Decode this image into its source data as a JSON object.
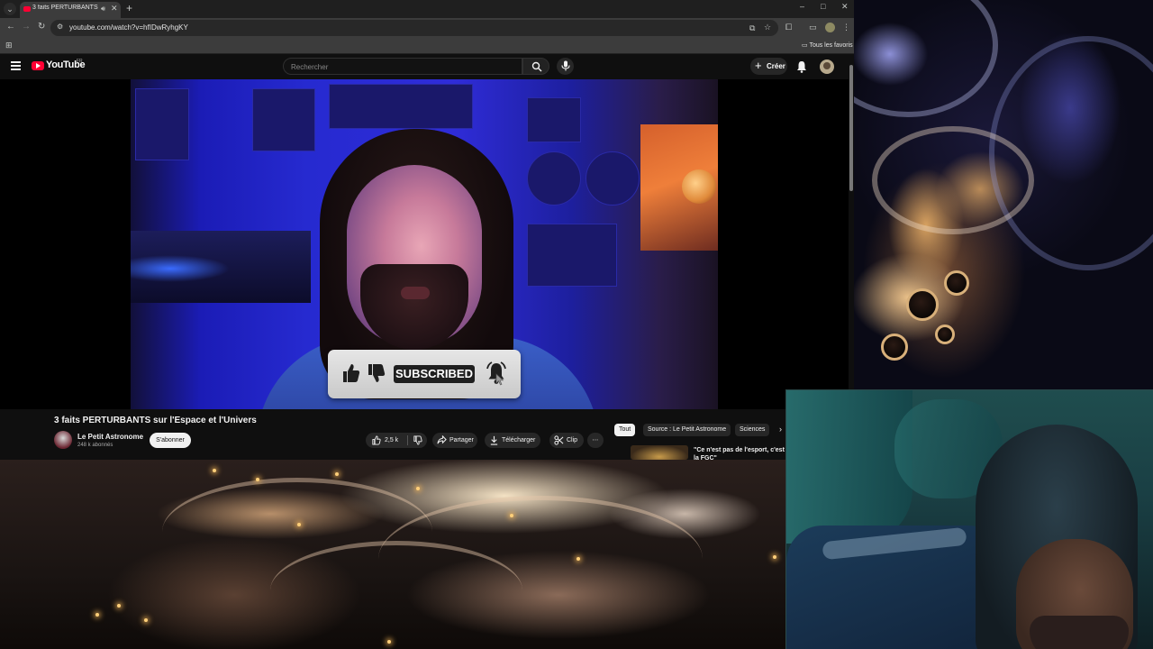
{
  "browser": {
    "tab_title": "3 faits PERTURBANTS sur l'Espace et l'Univers - YouTube",
    "url": "youtube.com/watch?v=hfIDwRyhgKY",
    "bookmarks_folder": "Tous les favoris",
    "window_controls": {
      "minimize": "–",
      "maximize": "□",
      "close": "✕"
    }
  },
  "youtube": {
    "wordmark": "YouTube",
    "country_code": "FR",
    "search_placeholder": "Rechercher",
    "create_label": "Créer"
  },
  "video": {
    "overlay_subscribed_text": "SUBSCRIBED",
    "title": "3 faits PERTURBANTS sur l'Espace et l'Univers",
    "channel_name": "Le Petit Astronome",
    "subscriber_count": "248 k abonnés",
    "subscribe_label": "S'abonner",
    "like_count": "2,5 k",
    "share_label": "Partager",
    "download_label": "Télécharger",
    "clip_label": "Clip",
    "more_label": "⋯"
  },
  "recommendations": {
    "chips": [
      "Tout",
      "Source : Le Petit Astronome",
      "Sciences"
    ],
    "chip_next": "›",
    "first_item_title": "\"Ce n'est pas de l'esport, c'est la FGC\""
  },
  "colors": {
    "yt_red": "#ff0033",
    "background": "#0f0f0f",
    "chip_active_bg": "#f1f1f1"
  }
}
